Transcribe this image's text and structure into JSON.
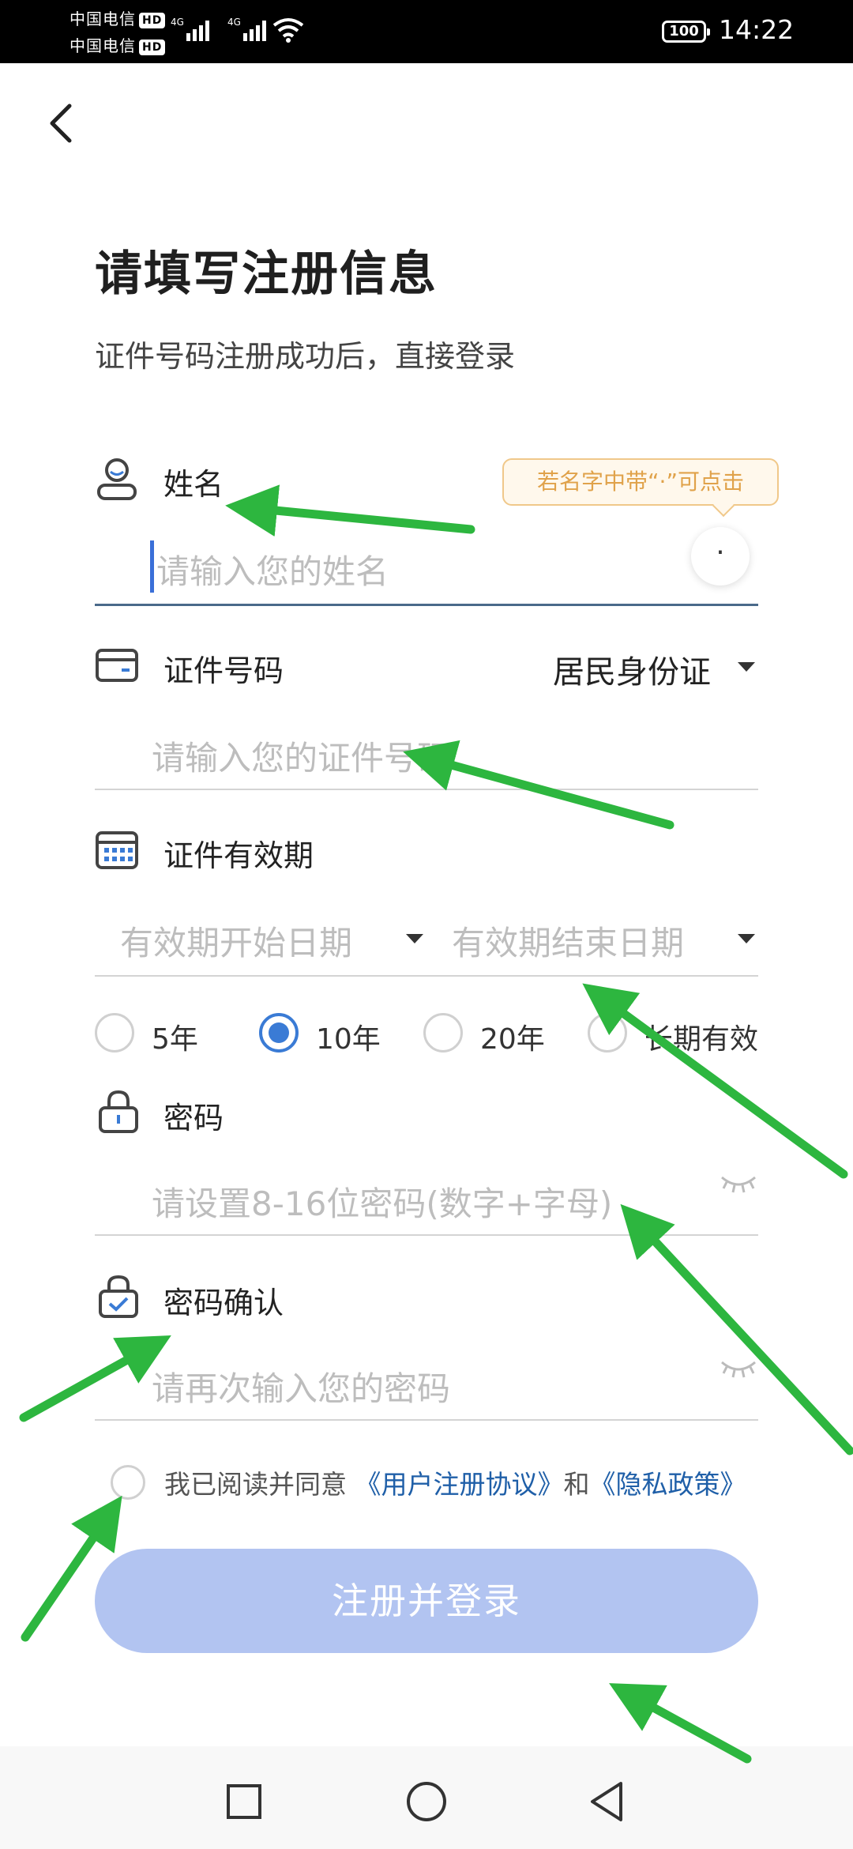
{
  "status_bar": {
    "carrier1": "中国电信",
    "carrier2": "中国电信",
    "hd": "HD",
    "net1": "4G",
    "net2": "4G",
    "battery": "100",
    "time": "14:22"
  },
  "header": {
    "title": "请填写注册信息",
    "subtitle": "证件号码注册成功后，直接登录"
  },
  "name_section": {
    "label": "姓名",
    "placeholder": "请输入您的姓名",
    "tooltip": "若名字中带“·”可点击",
    "dot_button": "·"
  },
  "id_section": {
    "label": "证件号码",
    "doc_type": "居民身份证",
    "placeholder": "请输入您的证件号码"
  },
  "validity_section": {
    "label": "证件有效期",
    "start_placeholder": "有效期开始日期",
    "end_placeholder": "有效期结束日期",
    "options": [
      "5年",
      "10年",
      "20年",
      "长期有效"
    ],
    "selected": "10年"
  },
  "password_section": {
    "label": "密码",
    "placeholder": "请设置8-16位密码(数字+字母)"
  },
  "confirm_section": {
    "label": "密码确认",
    "placeholder": "请再次输入您的密码"
  },
  "agreement": {
    "prefix": "我已阅读并同意",
    "link1": "《用户注册协议》",
    "middle": "和",
    "link2": "《隐私政策》"
  },
  "submit": {
    "label": "注册并登录"
  },
  "colors": {
    "accent": "#3a7bd5",
    "button_disabled": "#b2c4f1",
    "tooltip_text": "#e0a24a",
    "link": "#1f5fa8",
    "annotation_arrow": "#2db63f"
  },
  "icons": [
    "back-arrow-icon",
    "user-icon",
    "card-icon",
    "calendar-icon",
    "lock-icon",
    "lock-check-icon",
    "eye-closed-icon",
    "dropdown-triangle-icon",
    "nav-square-icon",
    "nav-circle-icon",
    "nav-back-icon"
  ]
}
